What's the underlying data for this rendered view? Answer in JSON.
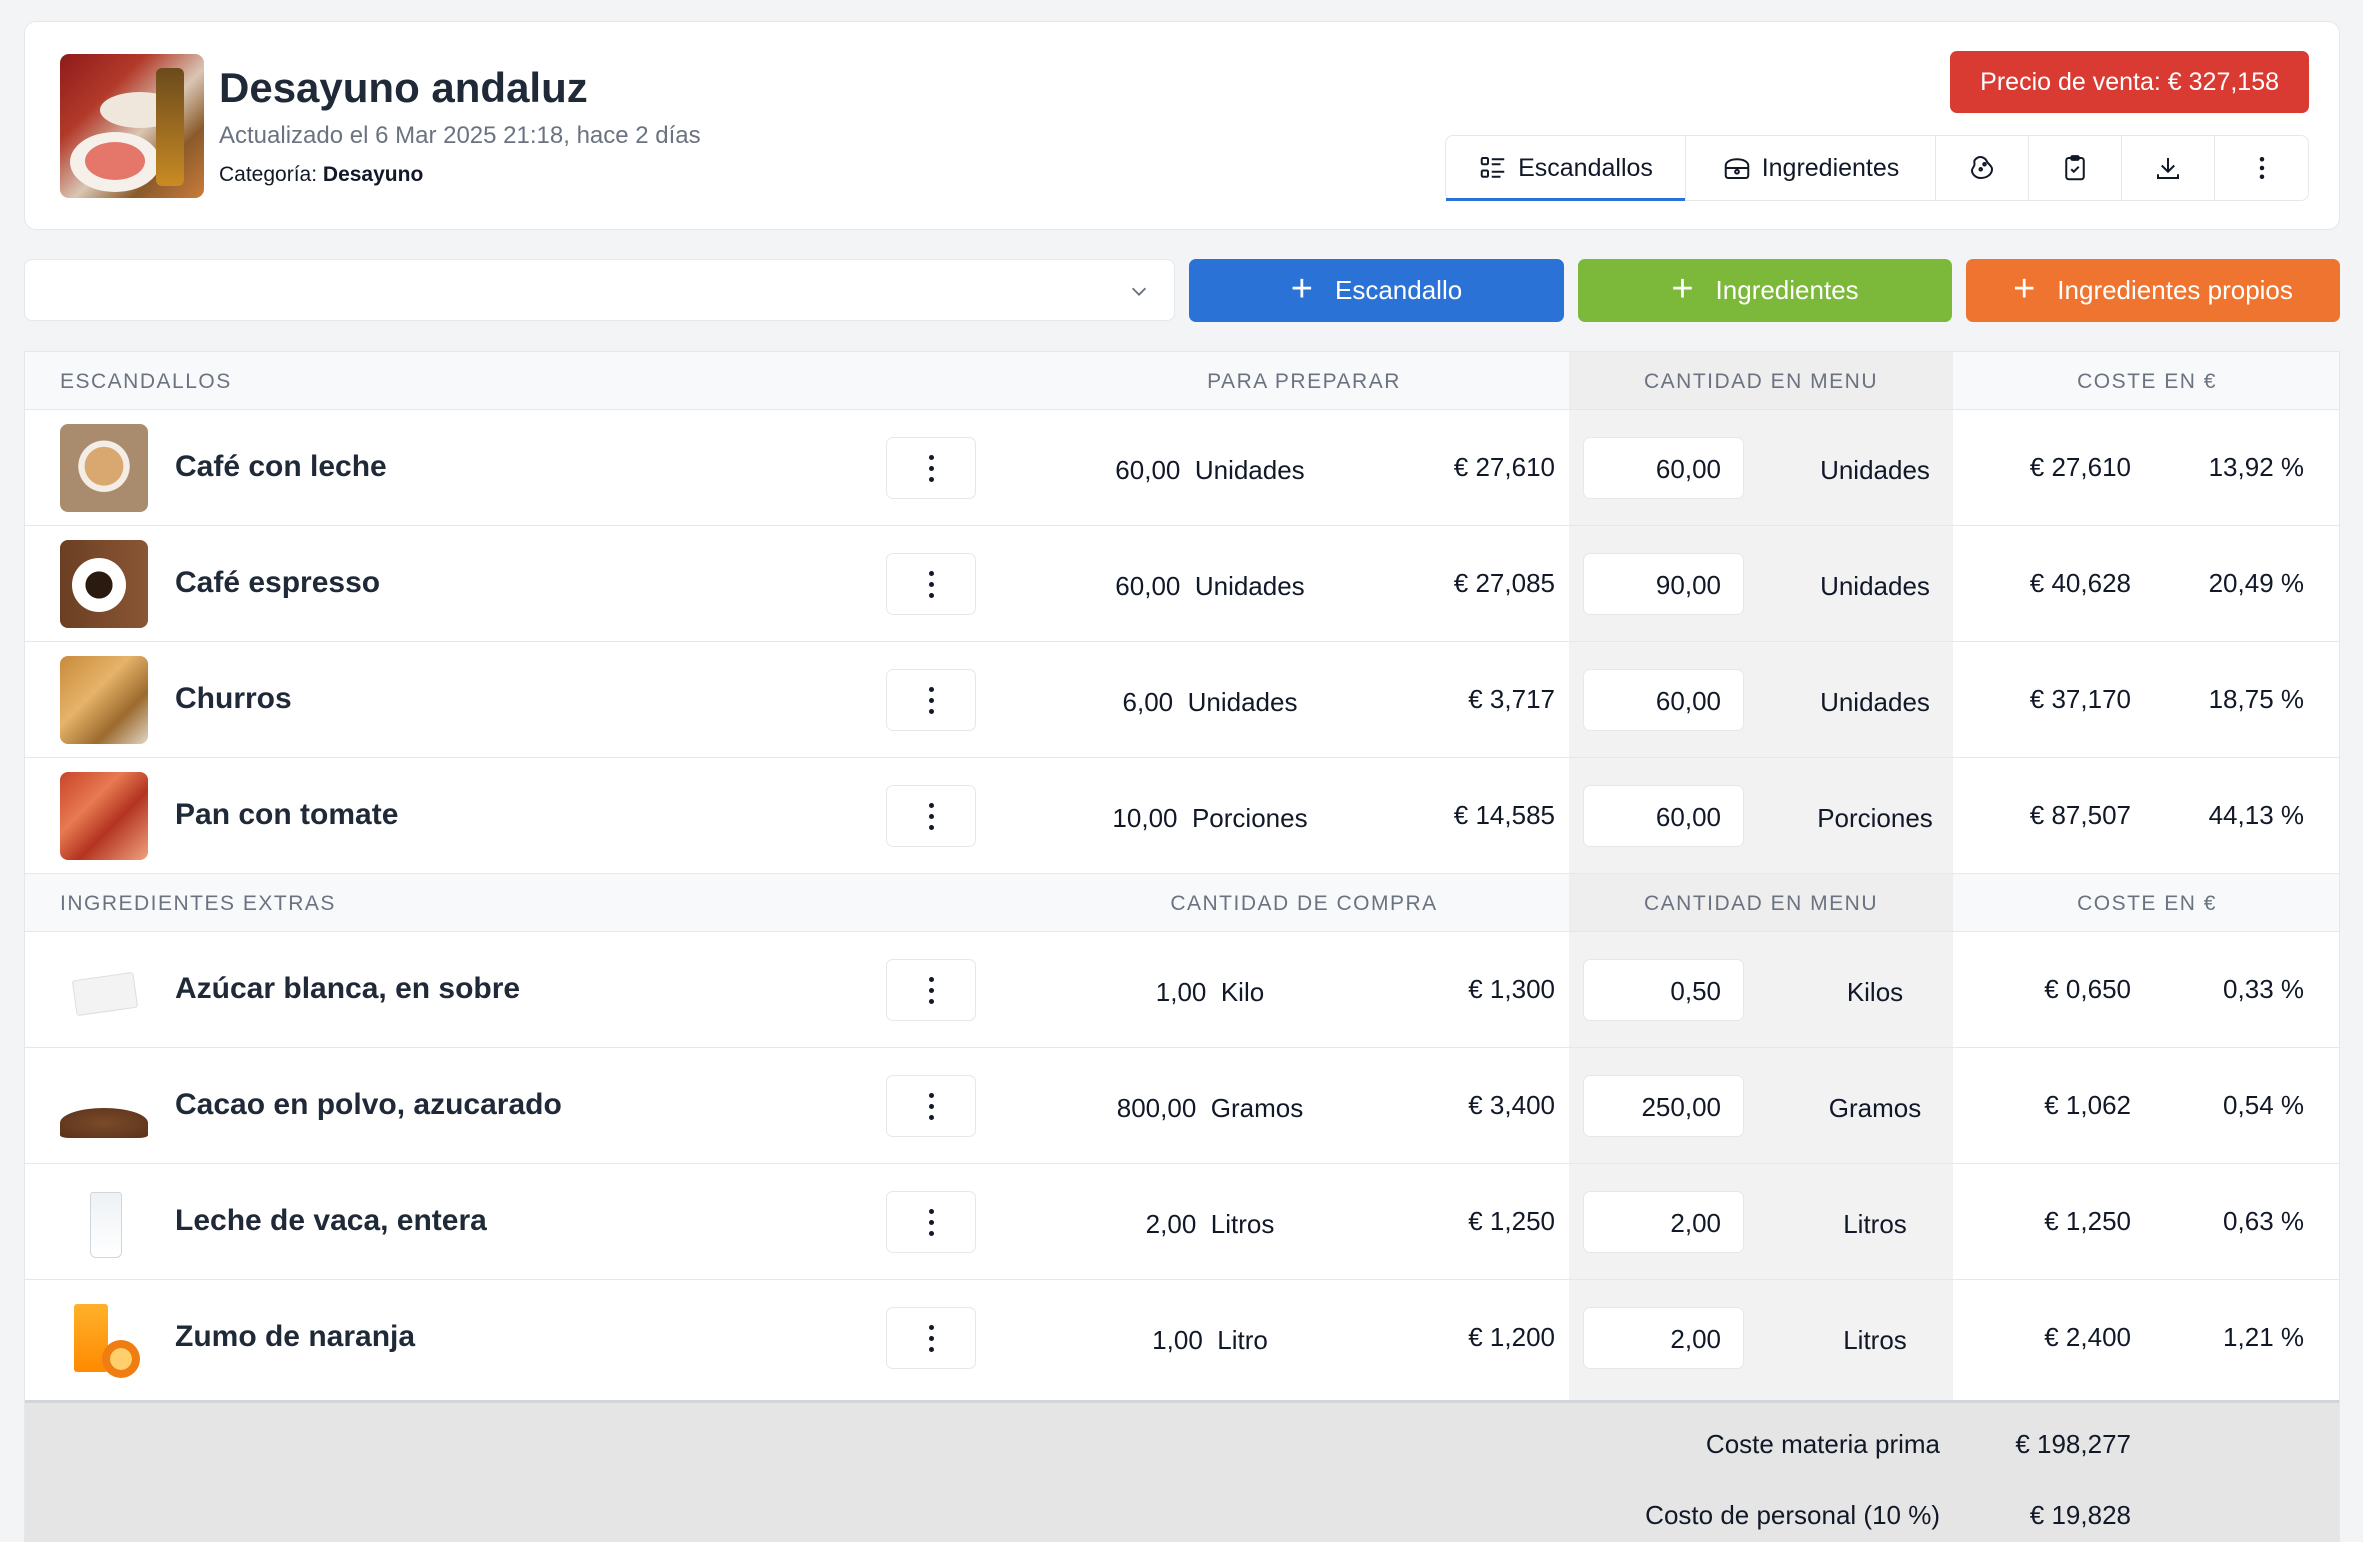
{
  "header": {
    "title": "Desayuno andaluz",
    "updated": "Actualizado el 6 Mar 2025 21:18, hace 2 días",
    "category_label": "Categoría:",
    "category_value": "Desayuno",
    "price_badge": "Precio de venta: € 327,158",
    "tabs": [
      {
        "label": "Escandallos",
        "icon": "list-icon",
        "active": true
      },
      {
        "label": "Ingredientes",
        "icon": "basket-icon",
        "active": false
      },
      {
        "label": "",
        "icon": "allergen-icon"
      },
      {
        "label": "",
        "icon": "clipboard-icon"
      },
      {
        "label": "",
        "icon": "download-icon"
      },
      {
        "label": "",
        "icon": "more-vertical-icon"
      }
    ]
  },
  "actions": {
    "filter_value": "",
    "add_escandallo": "Escandallo",
    "add_ingredientes": "Ingredientes",
    "add_propios": "Ingredientes propios"
  },
  "colors": {
    "price_badge": "#d93a32",
    "btn_escandallo": "#2b72d6",
    "btn_ingredientes": "#7cb83a",
    "btn_propios": "#ee7430"
  },
  "escandallos": {
    "headers": {
      "name": "ESCANDALLOS",
      "prep": "PARA PREPARAR",
      "menu_qty": "CANTIDAD EN MENU",
      "cost": "COSTE EN €"
    },
    "rows": [
      {
        "name": "Café con leche",
        "prep_qty": "60,00",
        "prep_unit": "Unidades",
        "prep_cost": "€ 27,610",
        "menu_qty": "60,00",
        "menu_unit": "Unidades",
        "cost": "€ 27,610",
        "pct": "13,92 %"
      },
      {
        "name": "Café espresso",
        "prep_qty": "60,00",
        "prep_unit": "Unidades",
        "prep_cost": "€ 27,085",
        "menu_qty": "90,00",
        "menu_unit": "Unidades",
        "cost": "€ 40,628",
        "pct": "20,49 %"
      },
      {
        "name": "Churros",
        "prep_qty": "6,00",
        "prep_unit": "Unidades",
        "prep_cost": "€ 3,717",
        "menu_qty": "60,00",
        "menu_unit": "Unidades",
        "cost": "€ 37,170",
        "pct": "18,75 %"
      },
      {
        "name": "Pan con tomate",
        "prep_qty": "10,00",
        "prep_unit": "Porciones",
        "prep_cost": "€ 14,585",
        "menu_qty": "60,00",
        "menu_unit": "Porciones",
        "cost": "€ 87,507",
        "pct": "44,13 %"
      }
    ]
  },
  "extras": {
    "headers": {
      "name": "INGREDIENTES EXTRAS",
      "prep": "CANTIDAD DE COMPRA",
      "menu_qty": "CANTIDAD EN MENU",
      "cost": "COSTE EN €"
    },
    "rows": [
      {
        "name": "Azúcar blanca, en sobre",
        "prep_qty": "1,00",
        "prep_unit": "Kilo",
        "prep_cost": "€ 1,300",
        "menu_qty": "0,50",
        "menu_unit": "Kilos",
        "cost": "€ 0,650",
        "pct": "0,33 %"
      },
      {
        "name": "Cacao en polvo, azucarado",
        "prep_qty": "800,00",
        "prep_unit": "Gramos",
        "prep_cost": "€ 3,400",
        "menu_qty": "250,00",
        "menu_unit": "Gramos",
        "cost": "€ 1,062",
        "pct": "0,54 %"
      },
      {
        "name": "Leche de vaca, entera",
        "prep_qty": "2,00",
        "prep_unit": "Litros",
        "prep_cost": "€ 1,250",
        "menu_qty": "2,00",
        "menu_unit": "Litros",
        "cost": "€ 1,250",
        "pct": "0,63 %"
      },
      {
        "name": "Zumo de naranja",
        "prep_qty": "1,00",
        "prep_unit": "Litro",
        "prep_cost": "€ 1,200",
        "menu_qty": "2,00",
        "menu_unit": "Litros",
        "cost": "€ 2,400",
        "pct": "1,21 %"
      }
    ]
  },
  "totals": [
    {
      "label": "Coste materia prima",
      "value": "€ 198,277"
    },
    {
      "label": "Costo de personal (10 %)",
      "value": "€ 19,828"
    }
  ]
}
